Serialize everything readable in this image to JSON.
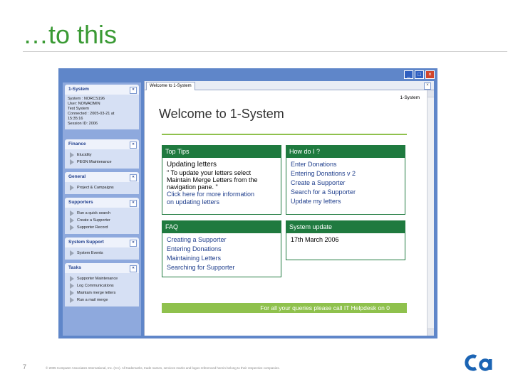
{
  "slide": {
    "title": "…to this",
    "page_number": "7",
    "copyright": "© 2005 Computer Associates International, Inc. (CA). All trademarks, trade names, services marks and logos referenced herein belong to their respective companies."
  },
  "window": {
    "tab_label": "Welcome to 1-System",
    "app_label": "1-System",
    "controls": {
      "minimize": "_",
      "maximize": "□",
      "close": "×"
    }
  },
  "sidebar": {
    "system": {
      "title": "1-System",
      "info": [
        "System : NORCS196",
        "User: NOWADMIN",
        "Test System",
        "Connected : 2005-03-21 at",
        "15:35:16",
        "Session ID: 2006"
      ]
    },
    "finance": {
      "title": "Finance",
      "items": [
        "Elucidity",
        "PEGN Maintenance"
      ]
    },
    "general": {
      "title": "General",
      "items": [
        "Project & Campaigns"
      ]
    },
    "supporters": {
      "title": "Supporters",
      "items": [
        "Run a quick search",
        "Create a Supporter",
        "Supporter Record"
      ]
    },
    "system_support": {
      "title": "System Support",
      "items": [
        "System Events"
      ]
    },
    "tasks": {
      "title": "Tasks",
      "items": [
        "Supporter Maintenance",
        "Log Communications",
        "Maintain merge letters",
        "Run a mail merge"
      ]
    }
  },
  "main": {
    "welcome": "Welcome to 1-System",
    "top_tips": {
      "header": "Top Tips",
      "heading": "Updating letters",
      "text": [
        "\" To update your letters select",
        "Maintain Merge Letters from the",
        "navigation pane. \""
      ],
      "links": [
        "Click here for more information",
        "on updating letters"
      ]
    },
    "how_do_i": {
      "header": "How do I ?",
      "items": [
        "Enter Donations",
        "Entering Donations v 2",
        "Create a Supporter",
        "Search for a Supporter",
        "Update my letters"
      ]
    },
    "faq": {
      "header": "FAQ",
      "items": [
        "Creating a Supporter",
        "Entering Donations",
        "Maintaining Letters",
        "Searching for Supporter"
      ]
    },
    "system_update": {
      "header": "System update",
      "date": "17th March 2006"
    },
    "footer": "For all your queries please call IT Helpdesk on 0"
  },
  "colors": {
    "accent_green": "#1f7a3f",
    "light_green": "#8fc14d",
    "title_green": "#3a9a34",
    "window_blue": "#5f86c9"
  }
}
